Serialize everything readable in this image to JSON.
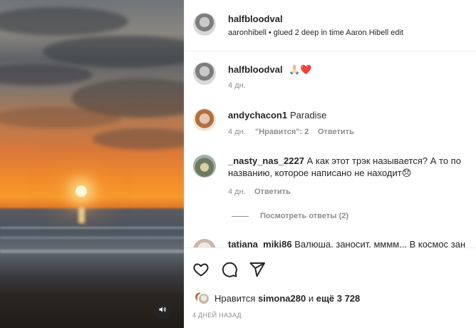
{
  "header": {
    "username": "halfbloodval",
    "subtitle": "aaronhibell • glued 2 deep in time Aaron Hibell edit"
  },
  "caption": {
    "username": "halfbloodval",
    "emoji": "🙏🏻❤️",
    "time": "4 дн."
  },
  "comments": [
    {
      "username": "andychacon1",
      "text": "Paradise",
      "time": "4 дн.",
      "likes_label": "\"Нравится\": 2",
      "reply_label": "Ответить"
    },
    {
      "username": "_nasty_nas_2227",
      "text_line1": "А как этот трэк называется? А то по",
      "text_line2": "названию, которое написано не находит😞",
      "time": "4 дн.",
      "reply_label": "Ответить",
      "view_replies_label": "Посмотреть ответы (2)"
    },
    {
      "username": "tatiana_miki86",
      "text": "Валюша, заносит, мммм... В космос зан"
    }
  ],
  "likes": {
    "prefix": "Нравится",
    "user": "simona280",
    "middle": "и",
    "others": "ещё 3 728"
  },
  "date_label": "4 ДНЕЙ НАЗАД",
  "icons": {
    "like": "heart-icon",
    "comment": "comment-bubble-icon",
    "share": "paper-plane-icon",
    "mute": "speaker-icon"
  }
}
